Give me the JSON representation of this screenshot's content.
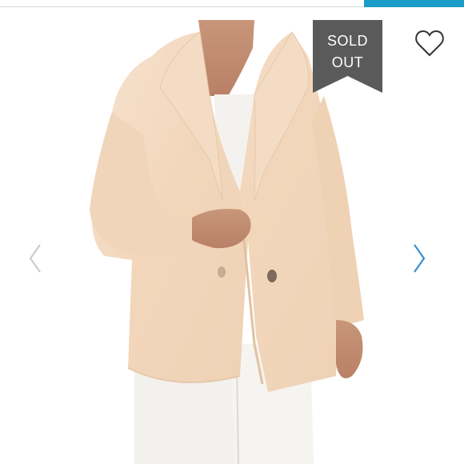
{
  "badge": {
    "line1": "SOLD",
    "line2": "OUT",
    "color": "#5a5a5a"
  },
  "icons": {
    "favorite": "heart-outline-icon",
    "prev": "chevron-left-icon",
    "next": "chevron-right-icon"
  },
  "colors": {
    "accent": "#1a9cc8",
    "nav_left": "#c8c8c8",
    "nav_right": "#3a8fcf"
  }
}
